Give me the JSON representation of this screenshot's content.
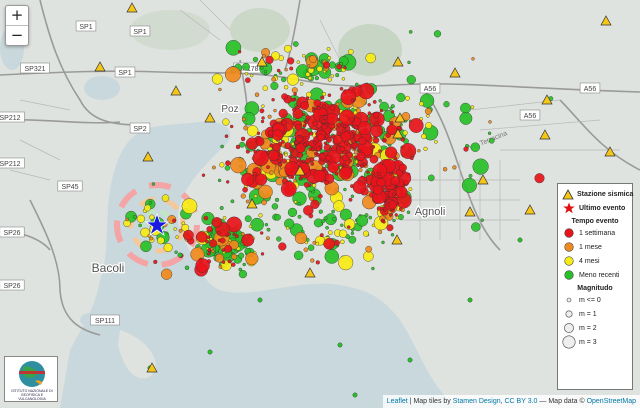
{
  "zoom": {
    "in_label": "+",
    "out_label": "−"
  },
  "road_labels": [
    {
      "text": "SP1"
    },
    {
      "text": "SP1"
    },
    {
      "text": "SP321"
    },
    {
      "text": "SP1"
    },
    {
      "text": "SP178"
    },
    {
      "text": "SP212"
    },
    {
      "text": "SP2"
    },
    {
      "text": "SP212"
    },
    {
      "text": "SP45"
    },
    {
      "text": "SP26"
    },
    {
      "text": "SP26"
    },
    {
      "text": "SP111"
    },
    {
      "text": "A56"
    },
    {
      "text": "A56"
    },
    {
      "text": "A56"
    }
  ],
  "place_labels": [
    "Bacoli",
    "Poz",
    "Agnoli"
  ],
  "street_label": "Via Terracina",
  "legend": {
    "station_label": "Stazione sismica",
    "last_event_label": "Ultimo evento",
    "time_title": "Tempo evento",
    "time_items": [
      {
        "label": "1 settimana",
        "color": "#e8141b"
      },
      {
        "label": "1 mese",
        "color": "#f08a1c"
      },
      {
        "label": "4 mesi",
        "color": "#f7ec14"
      },
      {
        "label": "Meno recenti",
        "color": "#27c127"
      }
    ],
    "mag_title": "Magnitudo",
    "mag_items": [
      "m <= 0",
      "m = 1",
      "m = 2",
      "m = 3"
    ]
  },
  "logo_text": "ISTITUTO NAZIONALE DI GEOFISICA E VULCANOLOGIA",
  "attribution": {
    "leaflet": "Leaflet",
    "part1": " | Map tiles by ",
    "stamen": "Stamen Design",
    "part2": ", ",
    "ccby": "CC BY 3.0",
    "part3": " — Map data © ",
    "osm": "OpenStreetMap"
  },
  "colors": {
    "red": "#e8141b",
    "orange": "#f08a1c",
    "yellow": "#f7ec14",
    "green": "#27c127",
    "station": "#f5c518",
    "star": "#e01010",
    "last_event_star": "#1a1ae0"
  }
}
